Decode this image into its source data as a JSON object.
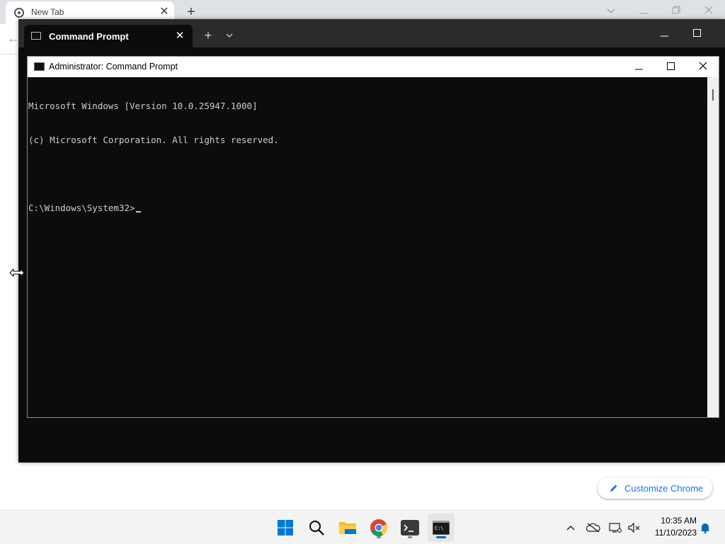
{
  "chrome": {
    "tab_title": "New Tab",
    "tab_close": "✕",
    "new_tab": "+",
    "customize_label": "Customize Chrome"
  },
  "terminal": {
    "tab_title": "Command Prompt",
    "tab_close": "✕",
    "new_tab": "+"
  },
  "cmd": {
    "window_title": "Administrator: Command Prompt",
    "lines": [
      "Microsoft Windows [Version 10.0.25947.1000]",
      "(c) Microsoft Corporation. All rights reserved.",
      "",
      "C:\\Windows\\System32>"
    ]
  },
  "taskbar": {
    "items": [
      "start-icon",
      "search-icon",
      "file-explorer-icon",
      "chrome-icon",
      "terminal-icon",
      "command-prompt-icon"
    ],
    "tray": [
      "show-hidden-icons-icon",
      "onedrive-icon",
      "network-icon",
      "volume-muted-icon"
    ],
    "time": "10:35 AM",
    "date": "11/10/2023"
  },
  "colors": {
    "console_bg": "#0c0c0c",
    "console_fg": "#cccccc",
    "accent": "#0067c0",
    "chrome_link": "#1a73e8"
  }
}
